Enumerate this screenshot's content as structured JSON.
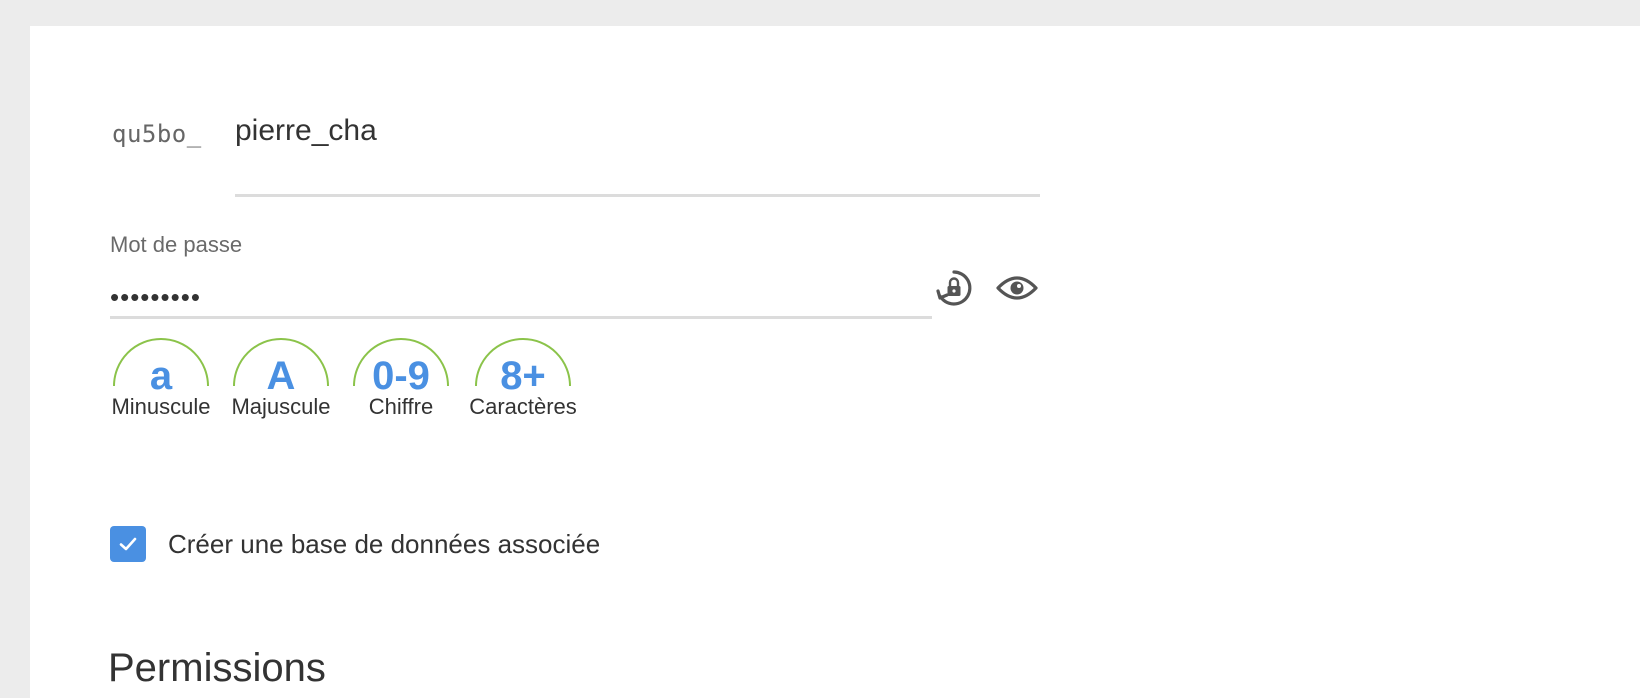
{
  "form": {
    "username_prefix": "qu5bo_",
    "username_value": "pierre_cha",
    "password_label": "Mot de passe",
    "password_value": "•••••••••",
    "regenerate_icon": "lock-refresh-icon",
    "visibility_icon": "eye-icon"
  },
  "criteria": [
    {
      "symbol": "a",
      "label": "Minuscule"
    },
    {
      "symbol": "A",
      "label": "Majuscule"
    },
    {
      "symbol": "0-9",
      "label": "Chiffre"
    },
    {
      "symbol": "8+",
      "label": "Caractères"
    }
  ],
  "database_option": {
    "label": "Créer une base de données associée",
    "checked": true
  },
  "permissions": {
    "title": "Permissions"
  },
  "colors": {
    "accent": "#4a90e2",
    "criteria_ok": "#8bc34a",
    "text": "#333333"
  }
}
